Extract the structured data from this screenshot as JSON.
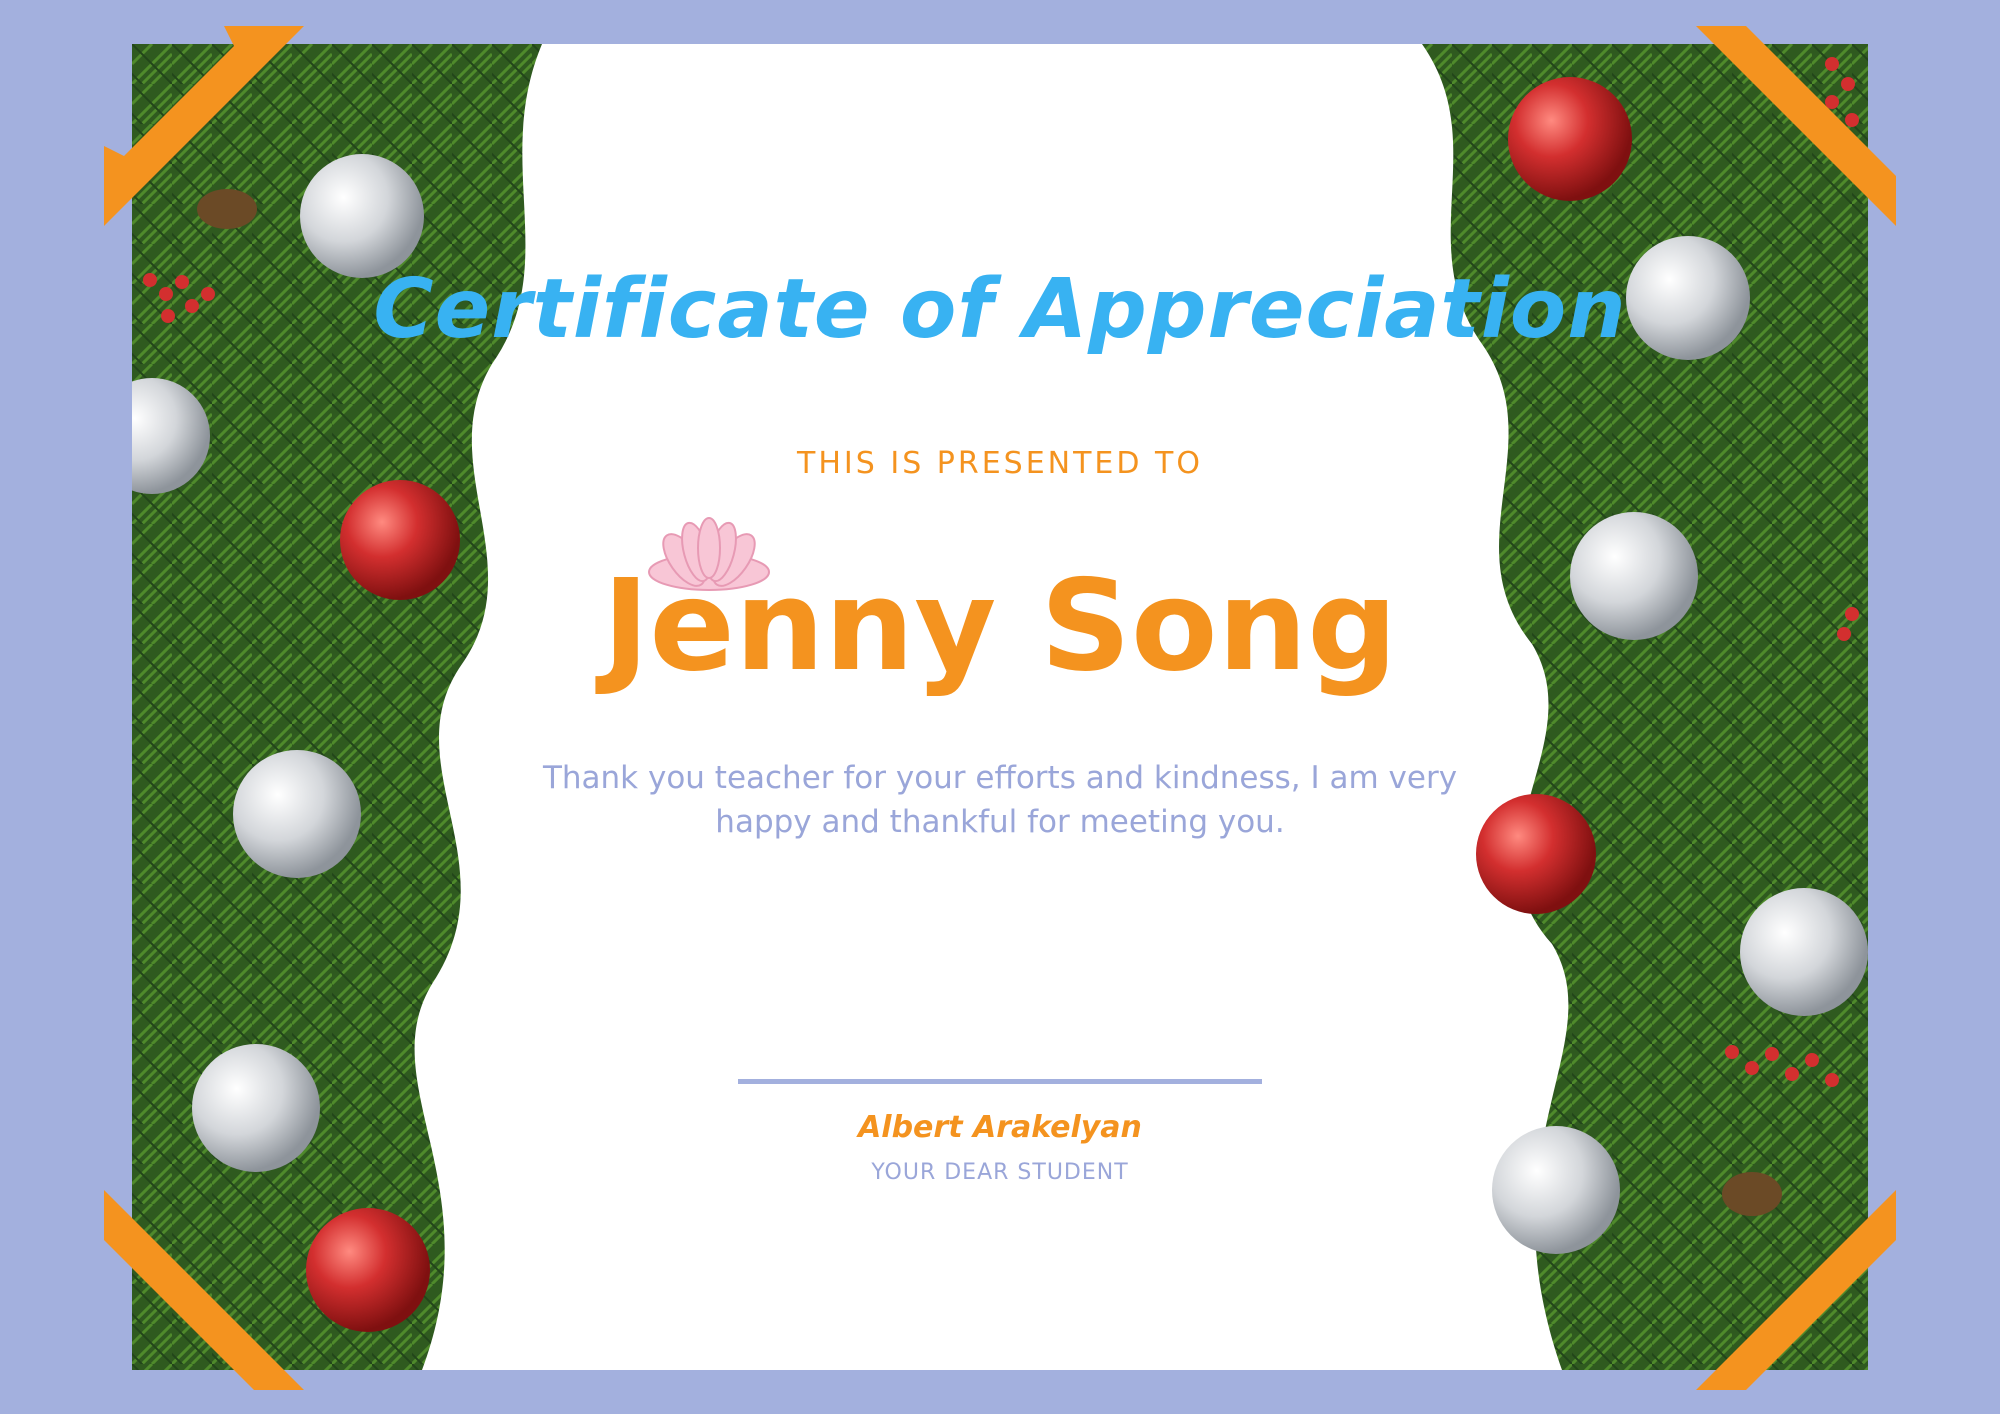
{
  "certificate": {
    "title": "Certificate of Appreciation",
    "presented_label": "THIS IS PRESENTED TO",
    "recipient_name": "Jenny Song",
    "message": "Thank you teacher for your efforts and kindness, I am very happy and thankful for meeting you.",
    "signer_name": "Albert Arakelyan",
    "signer_role": "YOUR DEAR STUDENT"
  },
  "colors": {
    "frame": "#a3b0de",
    "title": "#38b2f2",
    "accent": "#f4931f",
    "muted_text": "#9aa6d9",
    "pine_dark": "#2f5a1f",
    "pine_light": "#4f8a2b",
    "ornament_red": "#c62828",
    "ornament_silver": "#cfd3d8"
  },
  "decorations": {
    "left_garland": "pine-garland-with-ornaments",
    "right_garland": "pine-garland-with-ornaments",
    "corner_icon": "photo-corner-orange-icon",
    "flower_icon": "pink-lotus-flower-icon"
  }
}
